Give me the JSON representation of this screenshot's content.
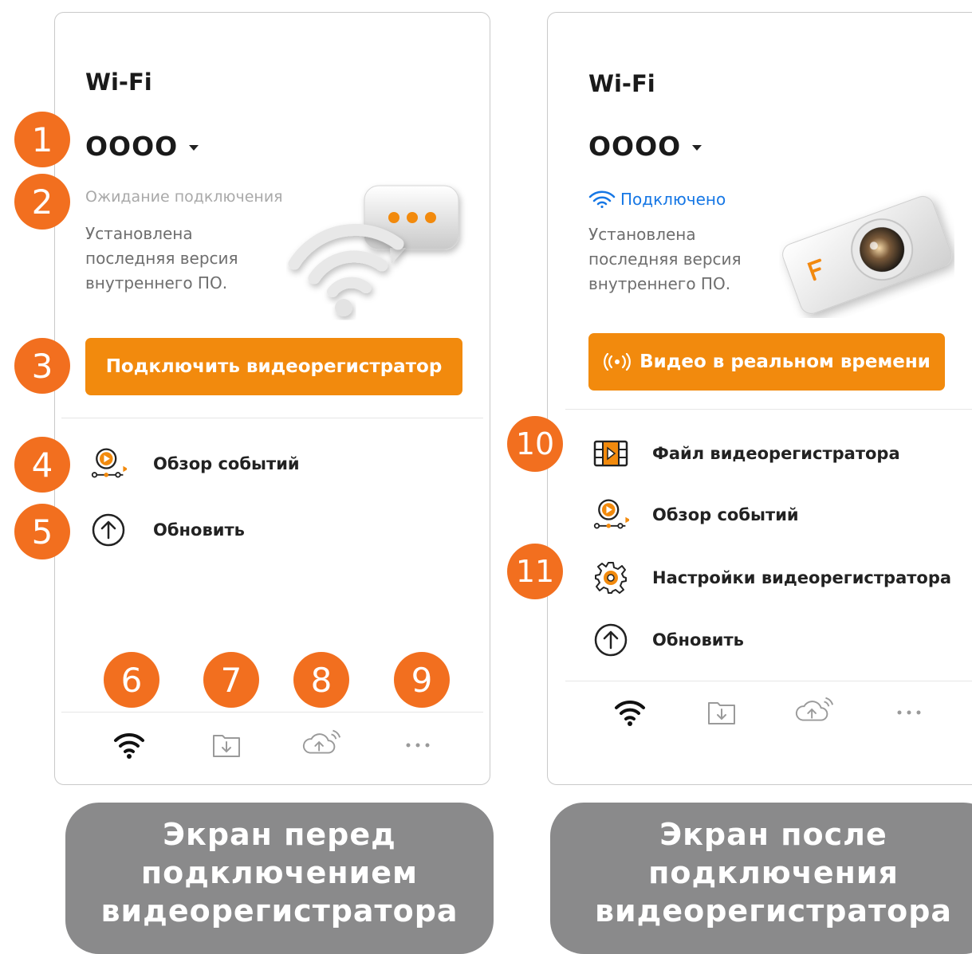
{
  "before": {
    "title": "Wi-Fi",
    "ssid": "OOOO",
    "status": "Ожидание подключения",
    "firmware": [
      "Установлена",
      "последняя версия",
      "внутреннего ПО."
    ],
    "primary_button": "Подключить видеорегистратор",
    "menu": [
      {
        "label": "Обзор событий",
        "icon": "event-review-icon"
      },
      {
        "label": "Обновить",
        "icon": "update-arrow-icon"
      }
    ],
    "tabs": [
      "wifi-icon",
      "download-folder-icon",
      "cloud-upload-icon",
      "more-icon"
    ],
    "caption": [
      "Экран перед",
      "подключением",
      "видеорегистратора"
    ]
  },
  "after": {
    "title": "Wi-Fi",
    "ssid": "OOOO",
    "status": "Подключено",
    "firmware": [
      "Установлена",
      "последняя версия",
      "внутреннего ПО."
    ],
    "primary_button": "Видео в реальном времени",
    "menu": [
      {
        "label": "Файл видеорегистратора",
        "icon": "video-file-icon"
      },
      {
        "label": "Обзор событий",
        "icon": "event-review-icon"
      },
      {
        "label": "Настройки видеорегистратора",
        "icon": "settings-gear-icon"
      },
      {
        "label": "Обновить",
        "icon": "update-arrow-icon"
      }
    ],
    "tabs": [
      "wifi-icon",
      "download-folder-icon",
      "cloud-upload-icon",
      "more-icon"
    ],
    "caption": [
      "Экран после",
      "подключения",
      "видеорегистратора"
    ]
  },
  "badges": [
    "1",
    "2",
    "3",
    "4",
    "5",
    "6",
    "7",
    "8",
    "9",
    "10",
    "11"
  ],
  "colors": {
    "accent": "#f28a0d",
    "badge": "#f26f1f",
    "connected": "#1677e5",
    "caption_bg": "#8a8a8b"
  }
}
